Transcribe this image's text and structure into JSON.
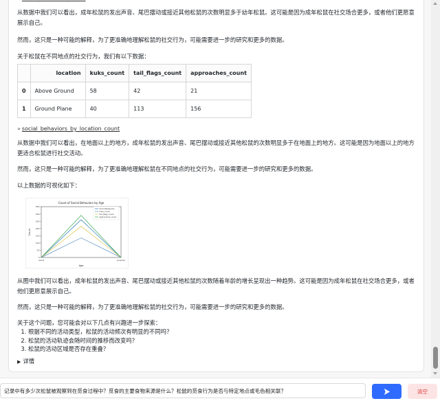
{
  "chat": {
    "top_link": "social_behaviors_count",
    "paragraph_1": "从数据中我们可以看出，成年松鼠的发出声音、尾巴摆动或接近其他松鼠的次数明显多于幼年松鼠。这可能是因为成年松鼠在社交场合更多，或者他们更愿意展示自己。",
    "paragraph_2": "然而，这只是一种可能的解释，为了更准确地理解松鼠的社交行为，可能需要进一步的研究和更多的数据。",
    "table_intro": "关于松鼠在不同地点的社交行为，我们有以下数据：",
    "table": {
      "headers": [
        "",
        "location",
        "kuks_count",
        "tail_flags_count",
        "approaches_count"
      ],
      "rows": [
        [
          "0",
          "Above Ground",
          "58",
          "42",
          "21"
        ],
        [
          "1",
          "Ground Plane",
          "40",
          "113",
          "156"
        ]
      ]
    },
    "link_2": "social_behaviors_by_location_count",
    "paragraph_3": "从数据中我们可以看出，在地面以上的地方，成年松鼠的发出声音、尾巴摆动或接近其他松鼠的次数明显多于在地面上的地方。这可能是因为地面以上的地方更适合松鼠进行社交活动。",
    "paragraph_4": "然而，这只是一种可能的解释，为了更准确地理解松鼠在不同地点的社交行为，可能需要进一步的研究和更多的数据。",
    "viz_intro": "以上数据的可视化如下：",
    "paragraph_5": "从图中我们可以看出，成年松鼠的发出声音、尾巴摆动或接近其他松鼠的次数随着年龄的增长呈现出一种趋势。这可能是因为成年松鼠在社交场合更多，或者他们更愿意展示自己。",
    "paragraph_6": "然而，这只是一种可能的解释，为了更准确地理解松鼠的社交行为，可能需要进一步的研究和更多的数据。",
    "followup_intro": "关于这个问题，您可能会对以下几点有兴趣进一步探索：",
    "followups": [
      "根据不同的活动类型，松鼠的活动频次有明显的不同吗？",
      "松鼠的活动轨迹会随时间的推移而改变吗？",
      "松鼠的活动区域是否存在重叠？"
    ],
    "details_label": "详情"
  },
  "chart_data": {
    "type": "line",
    "title": "Count of Social Behaviors by Age",
    "xlabel": "Age",
    "ylabel": "Count",
    "categories": [
      "Adult",
      "Juvenile"
    ],
    "ylim": [
      0,
      350
    ],
    "grid": false,
    "legend_position": "top-right",
    "series": [
      {
        "name": "Social Behaviors",
        "color": "#1f77b4",
        "values": [
          0,
          0
        ]
      },
      {
        "name": "kuks_count",
        "color": "#5b8fc7",
        "values": [
          0,
          0
        ]
      },
      {
        "name": "tail_flags_count",
        "color": "#d8c24a",
        "values": [
          0,
          0
        ]
      },
      {
        "name": "approaches_count",
        "color": "#3aa655",
        "values": [
          0,
          0
        ]
      }
    ],
    "peak_values": {
      "kuks_count": 135,
      "tail_flags_count": 215,
      "approaches_count": 290,
      "social_behaviors": 260
    }
  },
  "input": {
    "value": "记录中有多少次松鼠被观察到在觅食过程中？觅食的主要食物来源是什么？松鼠的觅食行为是否与特定地点或毛色相关联？"
  },
  "buttons": {
    "clear_label": "清空"
  },
  "colors": {
    "send_button": "#2f6bff",
    "clear_button_bg": "#fde4e4",
    "clear_button_text": "#e04040"
  }
}
